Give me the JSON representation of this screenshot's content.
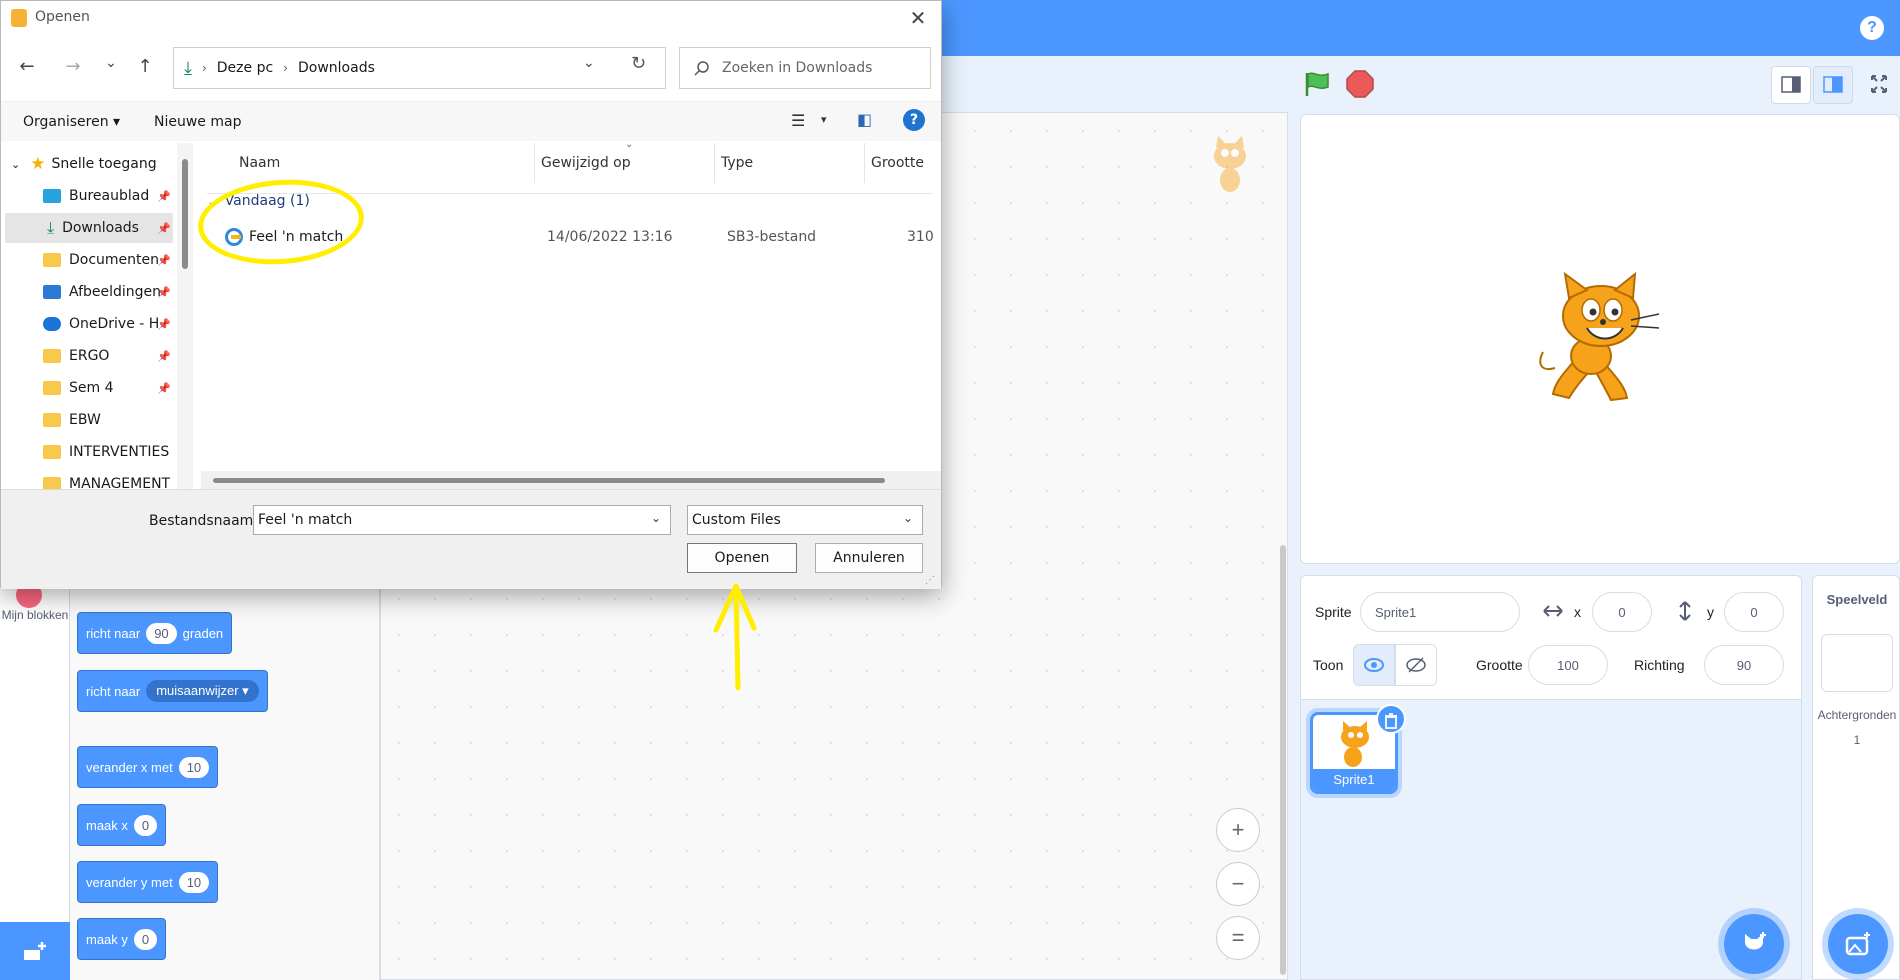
{
  "dialog": {
    "title": "Openen",
    "close_glyph": "✕",
    "nav": {
      "back": "←",
      "forward": "→",
      "recent": "⌄",
      "up": "↑"
    },
    "breadcrumb": [
      "Deze pc",
      "Downloads"
    ],
    "search_placeholder": "Zoeken in Downloads",
    "commands": {
      "organize": "Organiseren ▾",
      "new_folder": "Nieuwe map"
    },
    "nav_pane": [
      {
        "label": "Snelle toegang",
        "icon": "star-icon"
      },
      {
        "label": "Bureaublad",
        "icon": "desktop-icon",
        "pinned": true
      },
      {
        "label": "Downloads",
        "icon": "download-icon",
        "pinned": true,
        "selected": true
      },
      {
        "label": "Documenten",
        "icon": "folder-icon",
        "pinned": true
      },
      {
        "label": "Afbeeldingen",
        "icon": "pictures-icon",
        "pinned": true
      },
      {
        "label": "OneDrive - H",
        "icon": "onedrive-icon",
        "pinned": true
      },
      {
        "label": "ERGO",
        "icon": "folder-icon",
        "pinned": true
      },
      {
        "label": "Sem 4",
        "icon": "folder-icon",
        "pinned": true
      },
      {
        "label": "EBW",
        "icon": "folder-icon"
      },
      {
        "label": "INTERVENTIES",
        "icon": "folder-icon"
      },
      {
        "label": "MANAGEMENT",
        "icon": "folder-icon"
      }
    ],
    "columns": [
      "Naam",
      "Gewijzigd op",
      "Type",
      "Grootte"
    ],
    "group_label": "Vandaag (1)",
    "files": [
      {
        "name": "Feel 'n match",
        "modified": "14/06/2022 13:16",
        "type": "SB3-bestand",
        "size": "310"
      }
    ],
    "filename_label": "Bestandsnaam:",
    "filename_value": "Feel 'n match",
    "filetype_value": "Custom Files",
    "open_label": "Openen",
    "cancel_label": "Annuleren"
  },
  "scratch": {
    "help": "?",
    "blocks": {
      "point_dir_text": "richt naar",
      "point_dir_value": "90",
      "point_dir_unit": "graden",
      "point_towards_text": "richt naar",
      "point_towards_value": "muisaanwijzer ▾",
      "change_x_text": "verander x met",
      "change_x_value": "10",
      "set_x_text": "maak x",
      "set_x_value": "0",
      "change_y_text": "verander y met",
      "change_y_value": "10",
      "set_y_text": "maak y",
      "set_y_value": "0"
    },
    "my_blocks_label": "Mijn blokken",
    "zoom": {
      "in": "+",
      "out": "−",
      "reset": "="
    },
    "sprite_info": {
      "sprite_label": "Sprite",
      "sprite_name": "Sprite1",
      "x_label": "x",
      "x_value": "0",
      "y_label": "y",
      "y_value": "0",
      "show_label": "Toon",
      "size_label": "Grootte",
      "size_value": "100",
      "direction_label": "Richting",
      "direction_value": "90"
    },
    "sprite_tile_label": "Sprite1",
    "stage_panel": {
      "title": "Speelveld",
      "backdrops_label": "Achtergronden",
      "backdrops_count": "1"
    }
  },
  "colors": {
    "scratch_blue": "#4c97ff",
    "annotation_yellow": "#ffee00",
    "dialog_link": "#1f3d7a"
  }
}
